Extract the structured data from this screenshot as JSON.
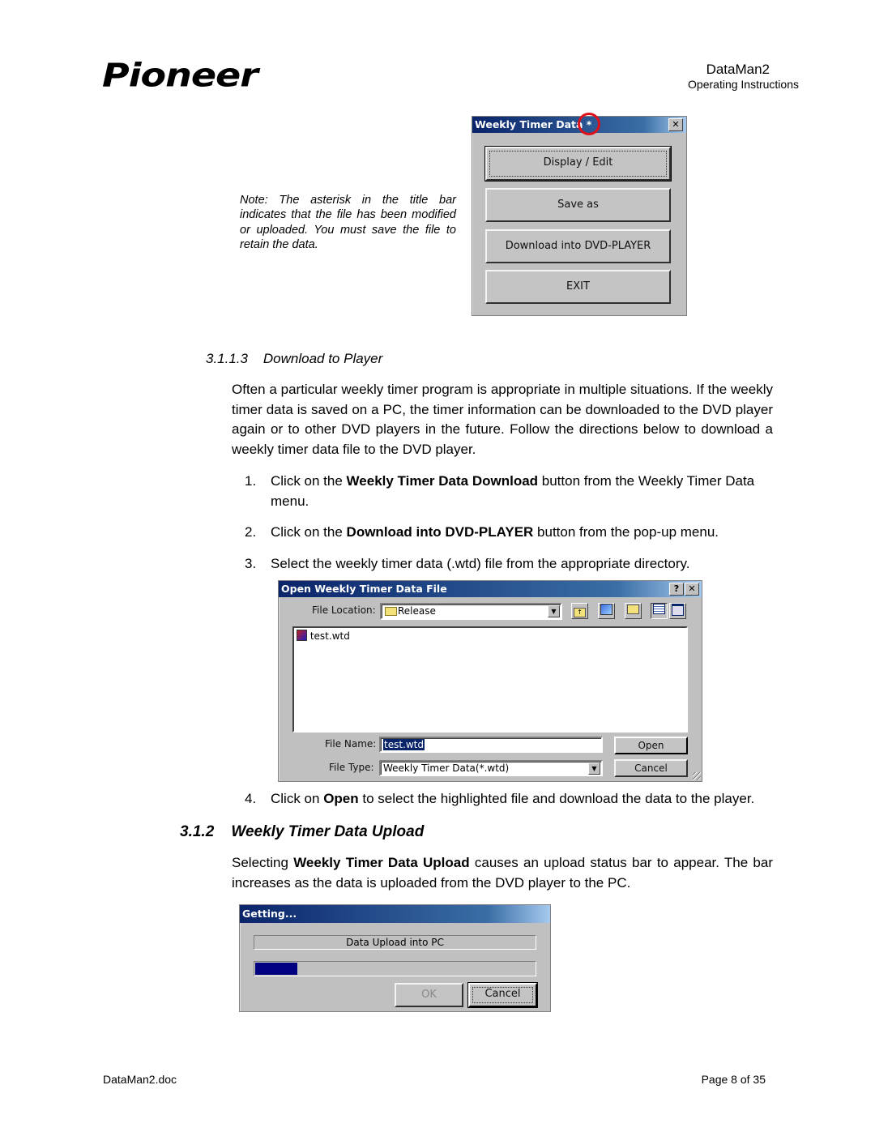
{
  "header": {
    "logo": "Pioneer",
    "doc_title": "DataMan2",
    "doc_subtitle": "Operating Instructions"
  },
  "note": "Note:  The asterisk in the title bar indicates that the file has been modified or uploaded. You must save the file to retain the data.",
  "weekly_timer_dialog": {
    "title": "Weekly Timer Data *",
    "close_glyph": "✕",
    "buttons": [
      "Display / Edit",
      "Save as",
      "Download into DVD-PLAYER",
      "EXIT"
    ]
  },
  "section_3113": {
    "heading": "3.1.1.3    Download to Player",
    "paragraph": "Often a particular weekly timer program is appropriate in multiple situations.  If the weekly timer data is saved on a PC, the timer information can be downloaded to the DVD player again or to other DVD players in the future.  Follow the directions below to download a weekly timer data file to the DVD player.",
    "steps": [
      {
        "num": "1.",
        "pre": "Click on the ",
        "bold": "Weekly Timer Data Download",
        "post": " button from the Weekly Timer Data menu."
      },
      {
        "num": "2.",
        "pre": "Click on the ",
        "bold": "Download into DVD-PLAYER",
        "post": " button from the pop-up menu."
      },
      {
        "num": "3.",
        "pre": "Select the weekly timer data (.wtd) file from the appropriate directory.",
        "bold": "",
        "post": ""
      },
      {
        "num": "4.",
        "pre": "Click on ",
        "bold": "Open",
        "post": " to select the highlighted file and download the data to the player."
      }
    ]
  },
  "open_dialog": {
    "title": "Open Weekly Timer Data File",
    "help_glyph": "?",
    "close_glyph": "✕",
    "file_location_label": "File Location:",
    "file_location_value": "Release",
    "toolbar_icons": [
      "up-folder",
      "desktop",
      "new-folder",
      "list-view",
      "details-view"
    ],
    "files": [
      "test.wtd"
    ],
    "file_name_label": "File Name:",
    "file_name_value": "test.wtd",
    "file_type_label": "File Type:",
    "file_type_value": "Weekly Timer Data(*.wtd)",
    "open_button": "Open",
    "cancel_button": "Cancel"
  },
  "section_312": {
    "heading": "3.1.2    Weekly Timer Data Upload",
    "pre": "Selecting ",
    "bold": "Weekly Timer Data Upload",
    "post": " causes an upload status bar to appear.  The bar increases as the data is uploaded from the DVD player to the PC."
  },
  "getting_dialog": {
    "title": "Getting...",
    "status_text": "Data Upload into PC",
    "progress_percent": 15,
    "progress_color": "#000080",
    "ok_button": "OK",
    "cancel_button": "Cancel"
  },
  "footer": {
    "filename": "DataMan2.doc",
    "page": "Page 8 of 35"
  }
}
